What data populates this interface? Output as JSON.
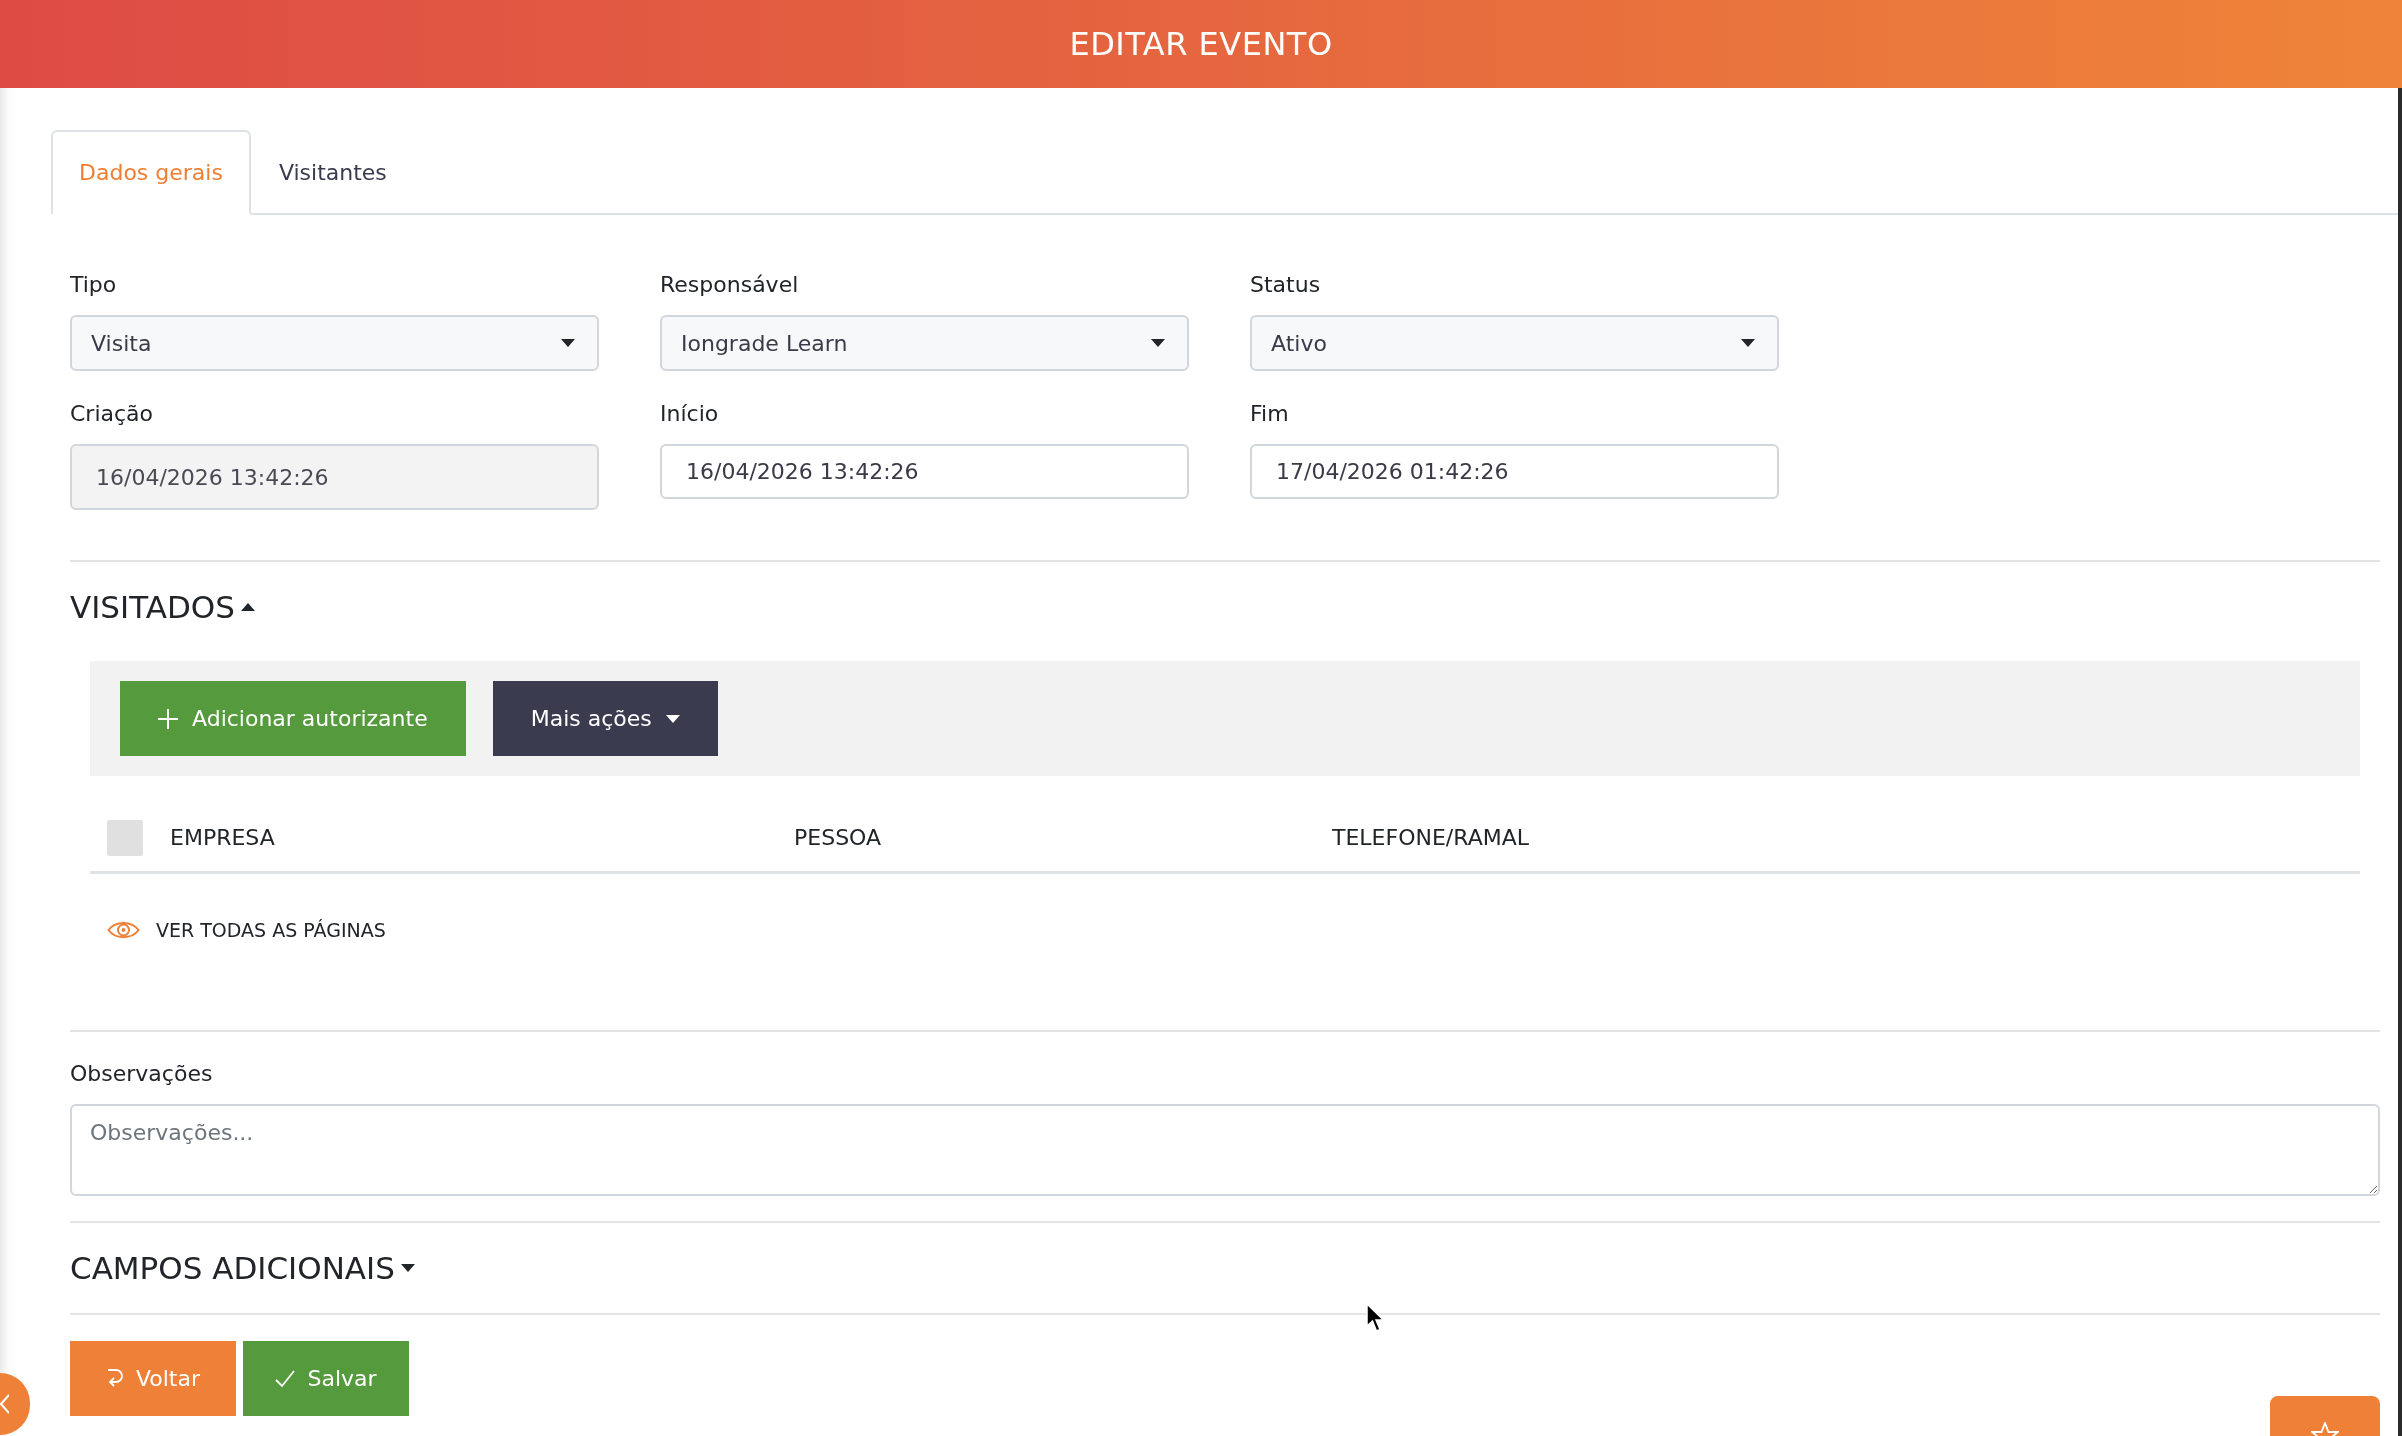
{
  "header": {
    "title": "EDITAR EVENTO"
  },
  "tabs": [
    {
      "label": "Dados gerais",
      "selected": true
    },
    {
      "label": "Visitantes",
      "selected": false
    }
  ],
  "fields": [
    {
      "label": "Tipo",
      "kind": "select",
      "value": "Visita",
      "disabled": false
    },
    {
      "label": "Responsável",
      "kind": "select",
      "value": "Iongrade Learn",
      "disabled": false
    },
    {
      "label": "Status",
      "kind": "select",
      "value": "Ativo",
      "disabled": false
    },
    {
      "label": "Criação",
      "kind": "text",
      "value": "16/04/2026 13:42:26",
      "disabled": true
    },
    {
      "label": "Início",
      "kind": "text",
      "value": "16/04/2026 13:42:26",
      "disabled": false
    },
    {
      "label": "Fim",
      "kind": "text",
      "value": "17/04/2026 01:42:26",
      "disabled": false
    }
  ],
  "visitados": {
    "title": "VISITADOS",
    "expanded": true,
    "actions": [
      {
        "kind": "add",
        "label": "Adicionar autorizante"
      },
      {
        "kind": "menu",
        "label": "Mais ações"
      }
    ],
    "table": {
      "select_all": {
        "checked": false
      },
      "columns": [
        "EMPRESA",
        "PESSOA",
        "TELEFONE/RAMAL"
      ]
    },
    "view_all": "VER TODAS AS PÁGINAS"
  },
  "observacoes": {
    "label": "Observações",
    "placeholder": "Observações..."
  },
  "campos_adicionais": {
    "title": "CAMPOS ADICIONAIS",
    "expanded": false
  },
  "footer": {
    "buttons": [
      {
        "kind": "back",
        "label": "Voltar"
      },
      {
        "kind": "save",
        "label": "Salvar"
      }
    ]
  }
}
